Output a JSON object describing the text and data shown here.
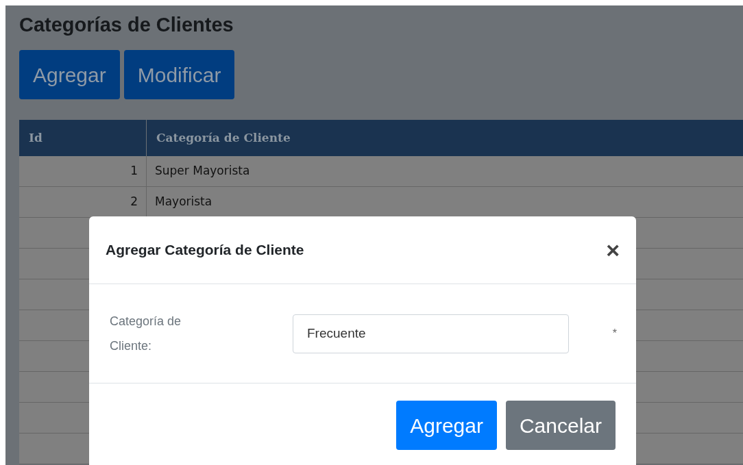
{
  "page": {
    "title": "Categorías de Clientes",
    "buttons": [
      "Agregar",
      "Modificar"
    ]
  },
  "table": {
    "columns": [
      "Id",
      "Categoría de Cliente"
    ],
    "rows": [
      {
        "id": "1",
        "name": "Super Mayorista"
      },
      {
        "id": "2",
        "name": "Mayorista"
      }
    ]
  },
  "modal": {
    "title": "Agregar Categoría de Cliente",
    "close": "×",
    "field": {
      "label": "Categoría de Cliente:",
      "value": "Frecuente",
      "required_mark": "*"
    },
    "buttons": [
      {
        "label": "Agregar",
        "kind": "primary"
      },
      {
        "label": "Cancelar",
        "kind": "secondary"
      }
    ]
  }
}
